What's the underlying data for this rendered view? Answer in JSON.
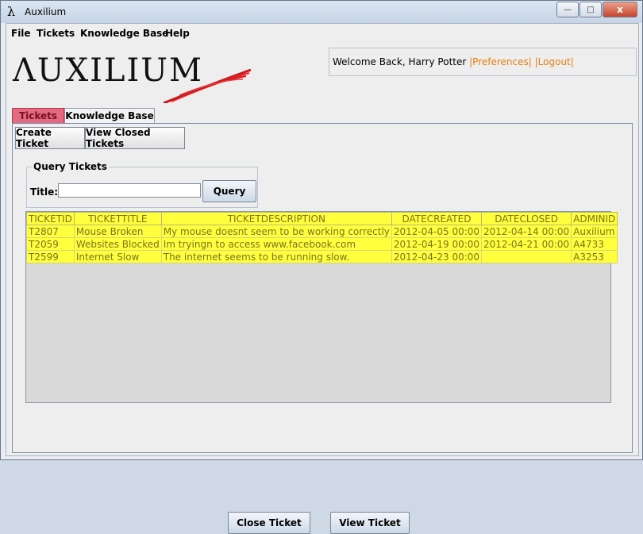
{
  "window": {
    "title": "Auxilium",
    "icon": "lambda-icon",
    "minimize": "—",
    "maximize": "□",
    "close": "x"
  },
  "menu": [
    "File",
    "Tickets",
    "Knowledge Base",
    "Help"
  ],
  "logo": {
    "text": "ΛUXILIUM"
  },
  "welcome": {
    "text": "Welcome Back, Harry Potter",
    "preferences": "|Preferences|",
    "logout": "|Logout|"
  },
  "tabs": [
    "Tickets",
    "Knowledge Base"
  ],
  "toolbar": {
    "create": "Create Ticket",
    "view_closed": "View Closed Tickets"
  },
  "query": {
    "legend": "Query Tickets",
    "title_label": "Title:",
    "title_value": "",
    "button": "Query"
  },
  "table": {
    "columns": [
      "TICKETID",
      "TICKETTITLE",
      "TICKETDESCRIPTION",
      "DATECREATED",
      "DATECLOSED",
      "ADMINID"
    ],
    "rows": [
      [
        "T2807",
        "Mouse Broken",
        "My mouse doesnt seem to be working correctly",
        "2012-04-05 00:00",
        "2012-04-14 00:00",
        "Auxilium"
      ],
      [
        "T2059",
        "Websites Blocked",
        "Im tryingn to access www.facebook.com",
        "2012-04-19 00:00",
        "2012-04-21 00:00",
        "A4733"
      ],
      [
        "T2599",
        "Internet Slow",
        "The internet seems to be running slow.",
        "2012-04-23 00:00",
        "",
        "A3253"
      ]
    ]
  },
  "buttons": {
    "close_ticket": "Close Ticket",
    "view_ticket": "View Ticket"
  }
}
